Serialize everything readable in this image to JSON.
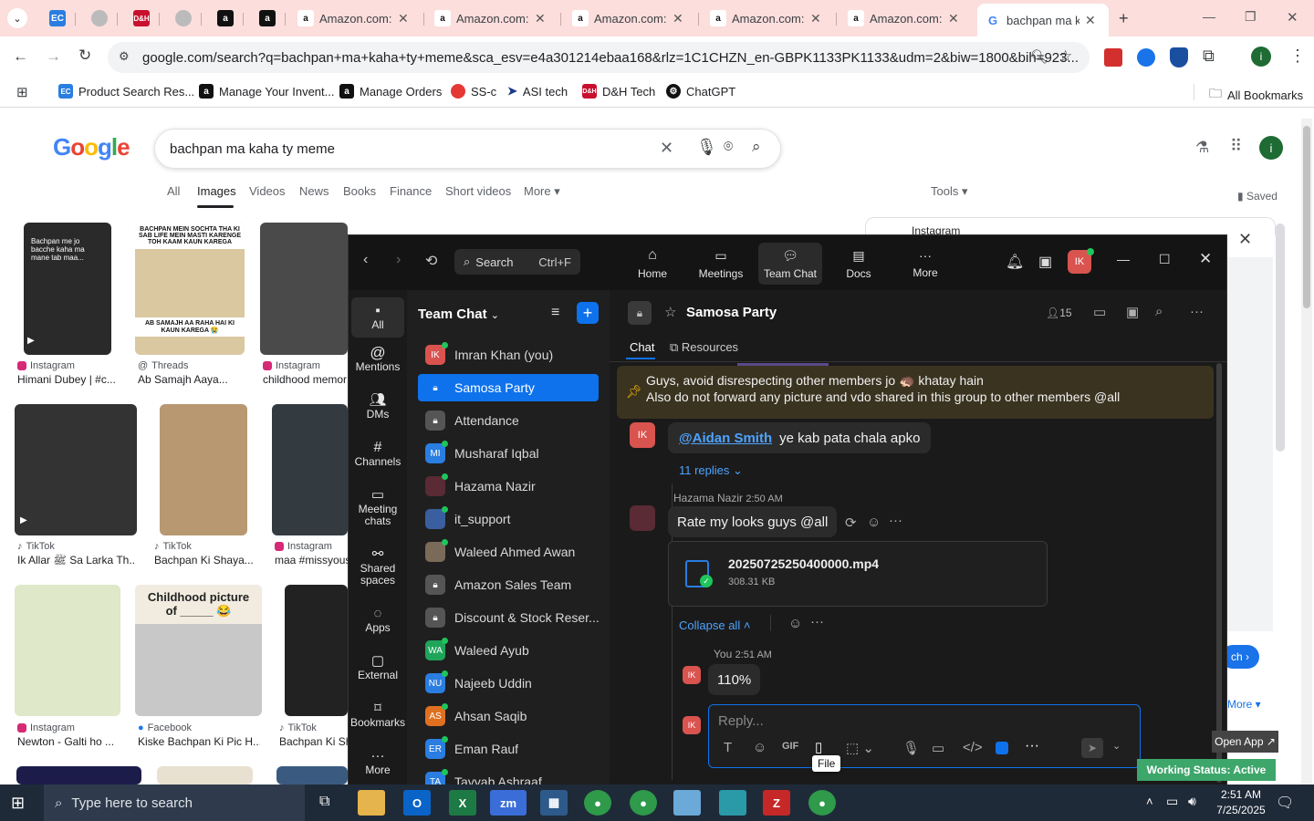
{
  "browser": {
    "tabs": [
      {
        "label": "",
        "icon": "ec-icon"
      },
      {
        "label": "",
        "icon": "globe-icon"
      },
      {
        "label": "",
        "icon": "dh-icon"
      },
      {
        "label": "",
        "icon": "globe-icon"
      },
      {
        "label": "",
        "icon": "amazon-icon"
      },
      {
        "label": "",
        "icon": "amazon-icon"
      },
      {
        "label": "Amazon.com: E",
        "icon": "amazon-icon"
      },
      {
        "label": "Amazon.com: E",
        "icon": "amazon-icon"
      },
      {
        "label": "Amazon.com: E",
        "icon": "amazon-icon"
      },
      {
        "label": "Amazon.com: E",
        "icon": "amazon-icon"
      },
      {
        "label": "Amazon.com: E",
        "icon": "amazon-icon"
      },
      {
        "label": "bachpan ma ka",
        "icon": "google-icon"
      }
    ],
    "url": "google.com/search?q=bachpan+ma+kaha+ty+meme&sca_esv=e4a301214ebaa168&rlz=1C1CHZN_en-GBPK1133PK1133&udm=2&biw=1800&bih=923...",
    "profile_initial": "i",
    "bookmarks": [
      "Product Search Res...",
      "Manage Your Invent...",
      "Manage Orders",
      "SS-c",
      "ASI tech",
      "D&H Tech",
      "ChatGPT"
    ],
    "all_bookmarks": "All Bookmarks"
  },
  "google": {
    "logo": "Google",
    "query": "bachpan ma kaha ty meme",
    "nav": [
      "All",
      "Images",
      "Videos",
      "News",
      "Books",
      "Finance",
      "Short videos",
      "More"
    ],
    "tools": "Tools",
    "saved": "Saved",
    "profile_initial": "i",
    "results": [
      {
        "source": "Instagram",
        "title": "Himani Dubey | #c..."
      },
      {
        "source": "Threads",
        "title": "Ab Samajh Aaya..."
      },
      {
        "source": "Instagram",
        "title": "childhood memori"
      },
      {
        "source": "TikTok",
        "title": "Ik Allar ﷺ Sa Larka Th..."
      },
      {
        "source": "TikTok",
        "title": "Bachpan Ki Shaya..."
      },
      {
        "source": "Instagram",
        "title": "maa #missyous"
      },
      {
        "source": "Instagram",
        "title": "Newton - Galti ho ..."
      },
      {
        "source": "Facebook",
        "title": "Kiske Bachpan Ki Pic H..."
      },
      {
        "source": "TikTok",
        "title": "Bachpan Ki Sh"
      }
    ],
    "thumb_texts": {
      "t1": "Bachpan me jo bacche kaha ma mane tab maa...",
      "t2_top": "BACHPAN MEIN SOCHTA THA KI SAB LIFE MEIN MASTI KARENGE TOH KAAM KAUN KAREGA",
      "t2_bottom": "AB SAMAJH AA RAHA HAI KI KAUN KAREGA 😭",
      "t8": "Childhood picture of _____ 😂"
    },
    "side_panel": {
      "source": "Instagram",
      "visit": "ch",
      "more": "More",
      "open_app": "Open App ↗"
    }
  },
  "zoom": {
    "top": {
      "search": "Search",
      "shortcut": "Ctrl+F",
      "tabs": [
        "Home",
        "Meetings",
        "Team Chat",
        "Docs",
        "More"
      ],
      "avatar": "IK"
    },
    "left_nav": [
      "All",
      "Mentions",
      "DMs",
      "Channels",
      "Meeting chats",
      "Shared spaces",
      "Apps",
      "External",
      "Bookmarks",
      "More"
    ],
    "list_title": "Team Chat",
    "list": [
      {
        "name": "Imran Khan (you)",
        "avatar": "IK",
        "color": "#d9534f",
        "kind": "user"
      },
      {
        "name": "Samosa Party",
        "avatar": "",
        "color": "#0e72ed",
        "kind": "lock"
      },
      {
        "name": "Attendance",
        "avatar": "",
        "color": "#555",
        "kind": "lock"
      },
      {
        "name": "Musharaf Iqbal",
        "avatar": "MI",
        "color": "#2a7de1",
        "kind": "user"
      },
      {
        "name": "Hazama Nazir",
        "avatar": "",
        "color": "#5a2a35",
        "kind": "user"
      },
      {
        "name": "it_support",
        "avatar": "",
        "color": "#3a5fa0",
        "kind": "user"
      },
      {
        "name": "Waleed Ahmed Awan",
        "avatar": "",
        "color": "#7a6a5a",
        "kind": "user"
      },
      {
        "name": "Amazon Sales Team",
        "avatar": "",
        "color": "#555",
        "kind": "lock"
      },
      {
        "name": "Discount & Stock Reser...",
        "avatar": "",
        "color": "#555",
        "kind": "lock"
      },
      {
        "name": "Waleed Ayub",
        "avatar": "WA",
        "color": "#1fa55a",
        "kind": "user"
      },
      {
        "name": "Najeeb Uddin",
        "avatar": "NU",
        "color": "#2a7de1",
        "kind": "user"
      },
      {
        "name": "Ahsan Saqib",
        "avatar": "AS",
        "color": "#e07020",
        "kind": "user"
      },
      {
        "name": "Eman Rauf",
        "avatar": "ER",
        "color": "#2a7de1",
        "kind": "user"
      },
      {
        "name": "Tayyab Ashraaf",
        "avatar": "TA",
        "color": "#2a7de1",
        "kind": "user"
      }
    ],
    "channel": {
      "name": "Samosa Party",
      "members": "15",
      "tabs": [
        "Chat",
        "Resources"
      ],
      "pinned_line1": "Guys, avoid disrespecting other members jo 🦔 khatay hain",
      "pinned_line2": "Also do not forward any picture and vdo shared in this group to other members @all",
      "msg1_avatar": "IK",
      "msg1_mention": "@Aidan Smith",
      "msg1_text": "ye kab pata chala apko",
      "replies": "11 replies",
      "msg2_author": "Hazama Nazir",
      "msg2_time": "2:50 AM",
      "msg2_text": "Rate my looks guys @all",
      "file_name": "20250725250400000.mp4",
      "file_size": "308.31 KB",
      "collapse": "Collapse all",
      "msg3_author": "You",
      "msg3_time": "2:51 AM",
      "msg3_avatar": "IK",
      "msg3_text": "110%",
      "reply_avatar": "IK",
      "reply_placeholder": "Reply...",
      "tooltip": "File",
      "status": "Working Status: Active"
    }
  },
  "taskbar": {
    "search_placeholder": "Type here to search",
    "time": "2:51 AM",
    "date": "7/25/2025"
  }
}
